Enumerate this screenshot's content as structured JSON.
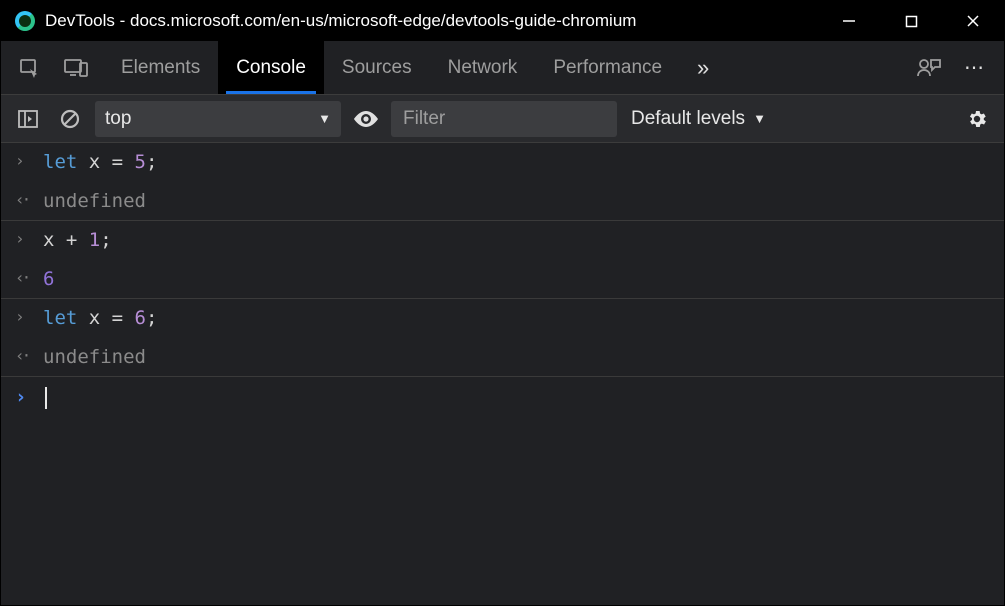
{
  "titlebar": {
    "title": "DevTools - docs.microsoft.com/en-us/microsoft-edge/devtools-guide-chromium"
  },
  "tabs": {
    "labels": [
      "Elements",
      "Console",
      "Sources",
      "Network",
      "Performance"
    ],
    "activeIndex": 1
  },
  "toolbar": {
    "context": "top",
    "filter_placeholder": "Filter",
    "levels_label": "Default levels"
  },
  "console": {
    "entries": [
      {
        "type": "input",
        "tokens": [
          {
            "t": "let ",
            "c": "kw"
          },
          {
            "t": "x ",
            "c": "op"
          },
          {
            "t": "= ",
            "c": "op"
          },
          {
            "t": "5",
            "c": "num"
          },
          {
            "t": ";",
            "c": "op"
          }
        ]
      },
      {
        "type": "output",
        "text": "undefined"
      },
      {
        "type": "input",
        "tokens": [
          {
            "t": "x ",
            "c": "op"
          },
          {
            "t": "+ ",
            "c": "op"
          },
          {
            "t": "1",
            "c": "num"
          },
          {
            "t": ";",
            "c": "op"
          }
        ]
      },
      {
        "type": "result",
        "tokens": [
          {
            "t": "6",
            "c": "num"
          }
        ]
      },
      {
        "type": "input",
        "tokens": [
          {
            "t": "let ",
            "c": "kw"
          },
          {
            "t": "x ",
            "c": "op"
          },
          {
            "t": "= ",
            "c": "op"
          },
          {
            "t": "6",
            "c": "num"
          },
          {
            "t": ";",
            "c": "op"
          }
        ]
      },
      {
        "type": "output",
        "text": "undefined"
      }
    ]
  }
}
